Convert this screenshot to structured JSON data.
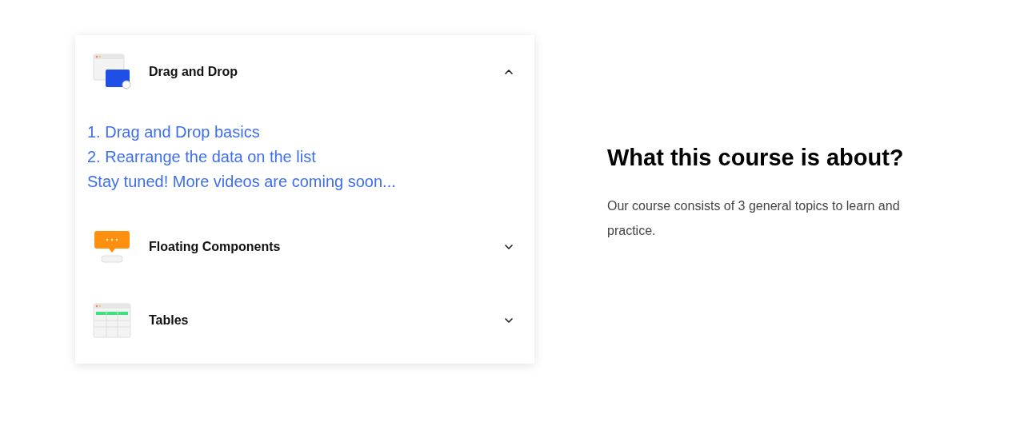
{
  "accordion": {
    "items": [
      {
        "kind": "drag",
        "title": "Drag and Drop",
        "expanded": true,
        "lessons": [
          "1. Drag and Drop basics",
          "2. Rearrange the data on the list",
          "Stay tuned! More videos are coming soon..."
        ]
      },
      {
        "kind": "floating",
        "title": "Floating Components",
        "expanded": false
      },
      {
        "kind": "tables",
        "title": "Tables",
        "expanded": false
      }
    ]
  },
  "about": {
    "heading": "What this course is about?",
    "text": "Our course consists of 3 general topics to learn and practice."
  }
}
